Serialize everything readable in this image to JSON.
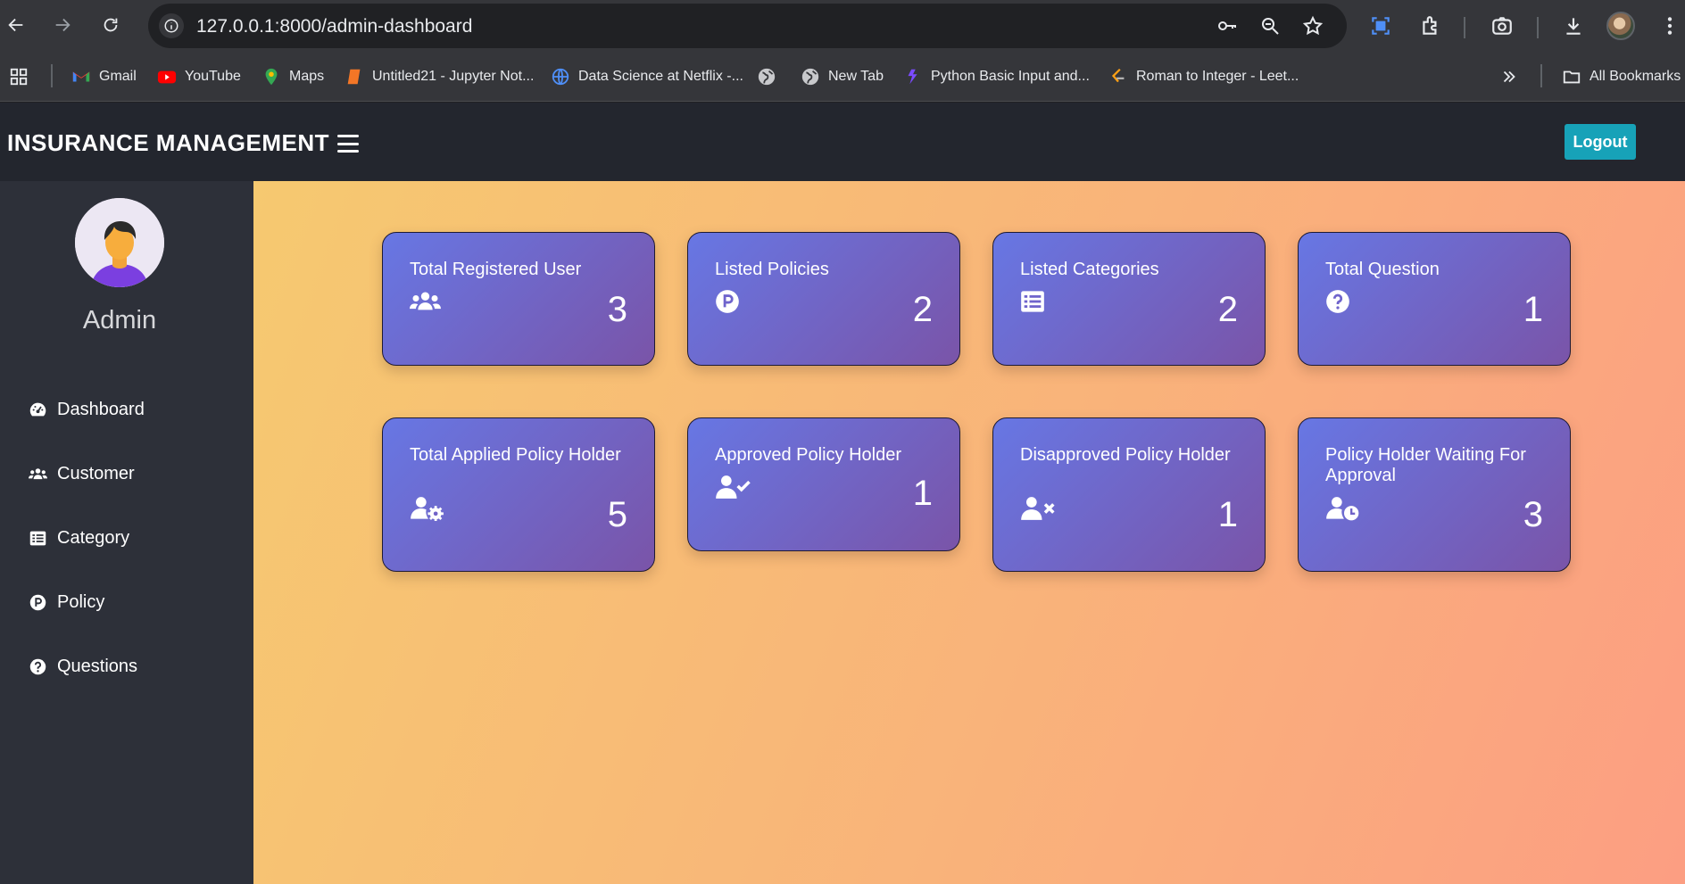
{
  "browser": {
    "url": "127.0.0.1:8000/admin-dashboard",
    "bookmarks": [
      {
        "label": "Gmail",
        "icon": "gmail-icon"
      },
      {
        "label": "YouTube",
        "icon": "youtube-icon"
      },
      {
        "label": "Maps",
        "icon": "maps-icon"
      },
      {
        "label": "Untitled21 - Jupyter Not...",
        "icon": "jupyter-icon"
      },
      {
        "label": "Data Science at Netflix -...",
        "icon": "globe-icon"
      },
      {
        "label": "",
        "icon": "globe-icon"
      },
      {
        "label": "New Tab",
        "icon": "globe-icon"
      },
      {
        "label": "Python Basic Input and...",
        "icon": "python-icon"
      },
      {
        "label": "Roman to Integer - Leet...",
        "icon": "leetcode-icon"
      }
    ],
    "all_bookmarks": "All Bookmarks"
  },
  "header": {
    "brand": "INSURANCE MANAGEMENT",
    "logout": "Logout"
  },
  "sidebar": {
    "admin_name": "Admin",
    "items": [
      {
        "label": "Dashboard",
        "icon": "dashboard-icon"
      },
      {
        "label": "Customer",
        "icon": "users-icon"
      },
      {
        "label": "Category",
        "icon": "list-icon"
      },
      {
        "label": "Policy",
        "icon": "policy-icon"
      },
      {
        "label": "Questions",
        "icon": "question-icon"
      }
    ]
  },
  "cards": [
    {
      "title": "Total Registered User",
      "value": "3",
      "icon": "users-icon"
    },
    {
      "title": "Listed Policies",
      "value": "2",
      "icon": "policy-icon"
    },
    {
      "title": "Listed Categories",
      "value": "2",
      "icon": "list-icon"
    },
    {
      "title": "Total Question",
      "value": "1",
      "icon": "question-icon"
    },
    {
      "title": "Total Applied Policy Holder",
      "value": "5",
      "icon": "user-gear-icon"
    },
    {
      "title": "Approved Policy Holder",
      "value": "1",
      "icon": "user-check-icon"
    },
    {
      "title": "Disapproved Policy Holder",
      "value": "1",
      "icon": "user-times-icon"
    },
    {
      "title": "Policy Holder Waiting For Approval",
      "value": "3",
      "icon": "user-clock-icon"
    }
  ],
  "colors": {
    "header_bg": "#23262e",
    "sidebar_bg": "#2d3039",
    "card_gradient_start": "#6777e4",
    "card_gradient_end": "#7a54a8",
    "logout_bg": "#17a2b8"
  }
}
